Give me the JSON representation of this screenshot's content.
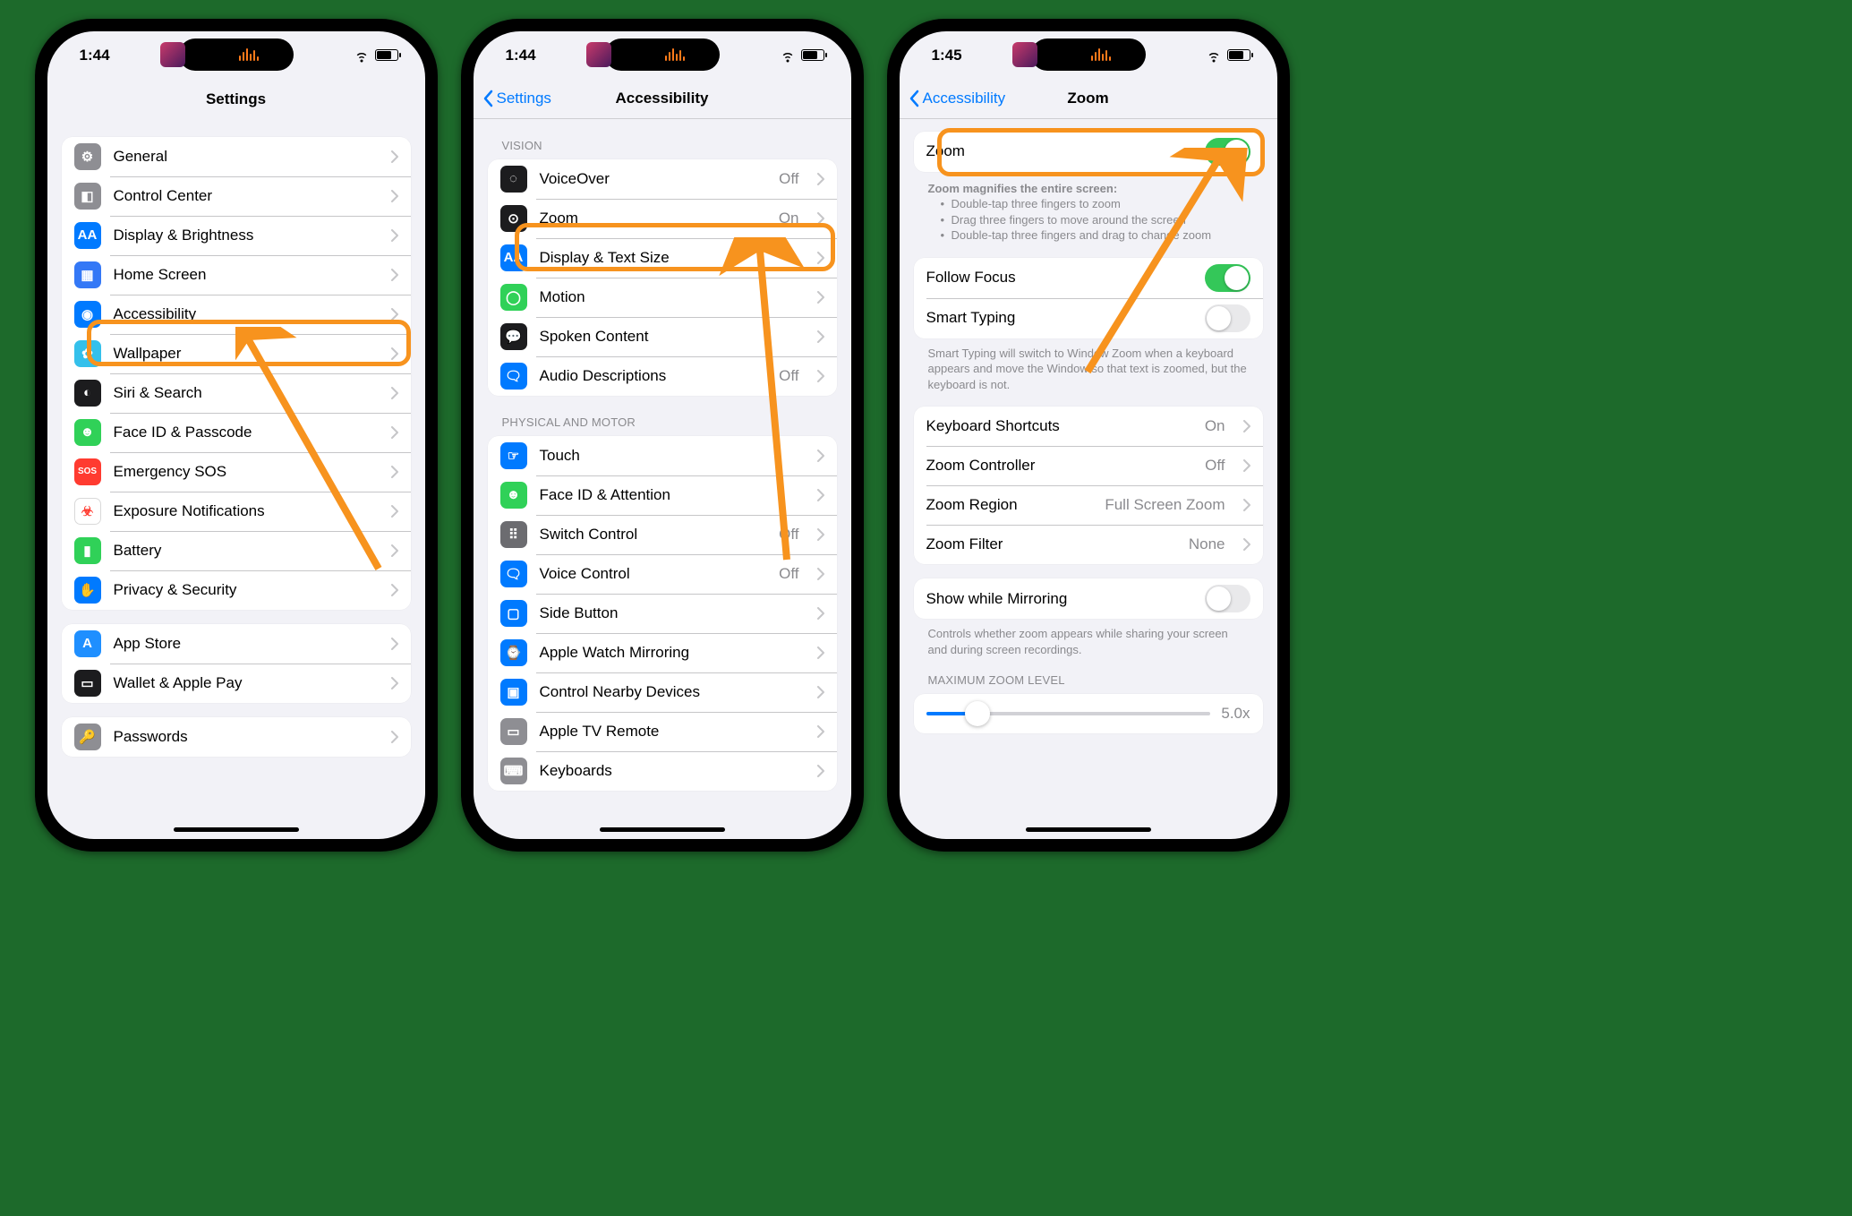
{
  "phone1": {
    "time": "1:44",
    "title": "Settings",
    "groups": [
      {
        "rows": [
          {
            "icon": "#8e8e93",
            "glyph": "⚙︎",
            "label": "General"
          },
          {
            "icon": "#8e8e93",
            "glyph": "◧",
            "label": "Control Center"
          },
          {
            "icon": "#007aff",
            "glyph": "AA",
            "label": "Display & Brightness"
          },
          {
            "icon": "#3478f6",
            "glyph": "▦",
            "label": "Home Screen"
          },
          {
            "icon": "#007aff",
            "glyph": "◉",
            "label": "Accessibility",
            "highlight": true
          },
          {
            "icon": "#34c0eb",
            "glyph": "✿",
            "label": "Wallpaper"
          },
          {
            "icon": "#1c1c1e",
            "glyph": "◐",
            "label": "Siri & Search"
          },
          {
            "icon": "#30d158",
            "glyph": "☻",
            "label": "Face ID & Passcode"
          },
          {
            "icon": "#ff3b30",
            "glyph": "SOS",
            "label": "Emergency SOS"
          },
          {
            "icon": "#ffffff",
            "glyph": "☣",
            "label": "Exposure Notifications",
            "iconBorder": true,
            "glyphColor": "#ff3b30"
          },
          {
            "icon": "#30d158",
            "glyph": "▮",
            "label": "Battery"
          },
          {
            "icon": "#007aff",
            "glyph": "✋",
            "label": "Privacy & Security"
          }
        ]
      },
      {
        "rows": [
          {
            "icon": "#1f8fff",
            "glyph": "A",
            "label": "App Store"
          },
          {
            "icon": "#1c1c1e",
            "glyph": "▭",
            "label": "Wallet & Apple Pay"
          }
        ]
      },
      {
        "rows": [
          {
            "icon": "#8e8e93",
            "glyph": "🔑",
            "label": "Passwords"
          }
        ]
      }
    ]
  },
  "phone2": {
    "time": "1:44",
    "back": "Settings",
    "title": "Accessibility",
    "sections": [
      {
        "header": "VISION",
        "rows": [
          {
            "icon": "#1c1c1e",
            "glyph": "◌",
            "label": "VoiceOver",
            "value": "Off"
          },
          {
            "icon": "#1c1c1e",
            "glyph": "⊙",
            "label": "Zoom",
            "value": "On",
            "highlight": true
          },
          {
            "icon": "#007aff",
            "glyph": "AA",
            "label": "Display & Text Size"
          },
          {
            "icon": "#30d158",
            "glyph": "◯",
            "label": "Motion"
          },
          {
            "icon": "#1c1c1e",
            "glyph": "💬",
            "label": "Spoken Content"
          },
          {
            "icon": "#007aff",
            "glyph": "🗨",
            "label": "Audio Descriptions",
            "value": "Off"
          }
        ]
      },
      {
        "header": "PHYSICAL AND MOTOR",
        "rows": [
          {
            "icon": "#007aff",
            "glyph": "☞",
            "label": "Touch"
          },
          {
            "icon": "#30d158",
            "glyph": "☻",
            "label": "Face ID & Attention"
          },
          {
            "icon": "#6c6c70",
            "glyph": "⠿",
            "label": "Switch Control",
            "value": "Off"
          },
          {
            "icon": "#007aff",
            "glyph": "🗨",
            "label": "Voice Control",
            "value": "Off"
          },
          {
            "icon": "#007aff",
            "glyph": "▢",
            "label": "Side Button"
          },
          {
            "icon": "#007aff",
            "glyph": "⌚",
            "label": "Apple Watch Mirroring"
          },
          {
            "icon": "#007aff",
            "glyph": "▣",
            "label": "Control Nearby Devices"
          },
          {
            "icon": "#8e8e93",
            "glyph": "▭",
            "label": "Apple TV Remote"
          },
          {
            "icon": "#8e8e93",
            "glyph": "⌨",
            "label": "Keyboards"
          }
        ]
      }
    ]
  },
  "phone3": {
    "time": "1:45",
    "back": "Accessibility",
    "title": "Zoom",
    "main_toggle": {
      "label": "Zoom",
      "on": true,
      "highlight": true
    },
    "desc_title": "Zoom magnifies the entire screen:",
    "desc_bullets": [
      "Double-tap three fingers to zoom",
      "Drag three fingers to move around the screen",
      "Double-tap three fingers and drag to change zoom"
    ],
    "group_toggles": [
      {
        "label": "Follow Focus",
        "on": true
      },
      {
        "label": "Smart Typing",
        "on": false
      }
    ],
    "smart_typing_footer": "Smart Typing will switch to Window Zoom when a keyboard appears and move the Window so that text is zoomed, but the keyboard is not.",
    "group_links": [
      {
        "label": "Keyboard Shortcuts",
        "value": "On"
      },
      {
        "label": "Zoom Controller",
        "value": "Off"
      },
      {
        "label": "Zoom Region",
        "value": "Full Screen Zoom"
      },
      {
        "label": "Zoom Filter",
        "value": "None"
      }
    ],
    "mirroring": {
      "label": "Show while Mirroring",
      "on": false
    },
    "mirroring_footer": "Controls whether zoom appears while sharing your screen and during screen recordings.",
    "max_zoom_header": "MAXIMUM ZOOM LEVEL",
    "max_zoom_value": "5.0x"
  }
}
